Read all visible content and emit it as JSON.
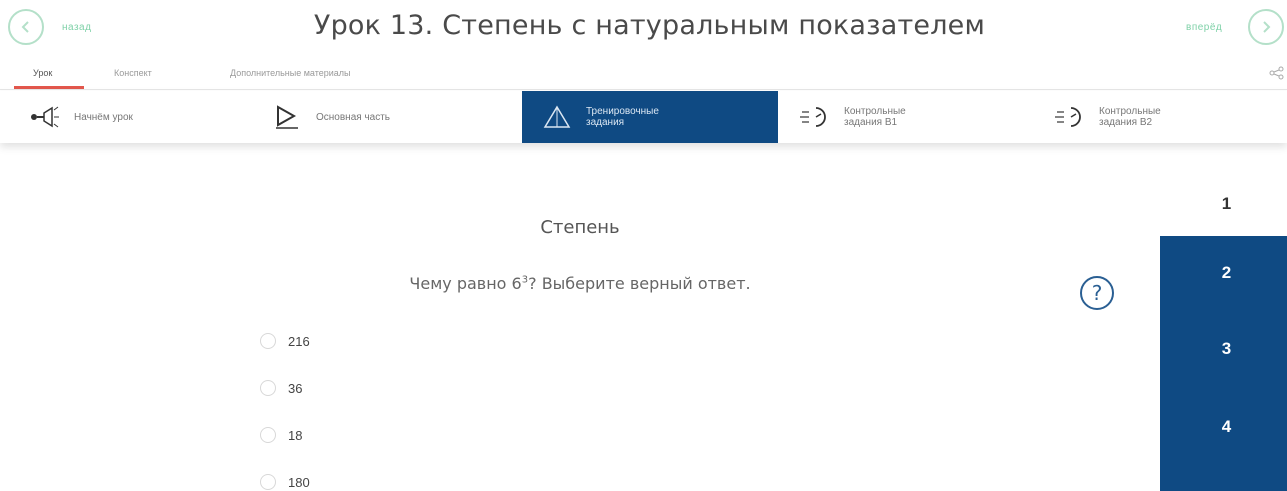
{
  "header": {
    "title": "Урок 13. Степень с натуральным показателем",
    "back_label": "назад",
    "forward_label": "вперёд"
  },
  "tabs": [
    {
      "label": "Урок",
      "active": true
    },
    {
      "label": "Конспект",
      "active": false
    },
    {
      "label": "Дополнительные материалы",
      "active": false
    }
  ],
  "sections": [
    {
      "label": "Начнём урок",
      "icon": "flashlight-icon"
    },
    {
      "label": "Основная часть",
      "icon": "play-screen-icon"
    },
    {
      "label_line1": "Тренировочные",
      "label_line2": "задания",
      "icon": "warning-triangle-icon",
      "active": true
    },
    {
      "label_line1": "Контрольные",
      "label_line2": "задания В1",
      "icon": "sound-stopwatch-icon"
    },
    {
      "label_line1": "Контрольные",
      "label_line2": "задания В2",
      "icon": "sound-stopwatch-icon"
    }
  ],
  "question": {
    "title": "Степень",
    "text_before": "Чему равно 6",
    "exponent": "3",
    "text_after": "? Выберите верный ответ.",
    "help_symbol": "?",
    "options": [
      "216",
      "36",
      "18",
      "180"
    ]
  },
  "navigator": [
    "1",
    "2",
    "3",
    "4"
  ],
  "colors": {
    "accent_blue": "#0f4a83",
    "accent_green": "#7fd1a8",
    "tab_underline": "#e2574c"
  }
}
